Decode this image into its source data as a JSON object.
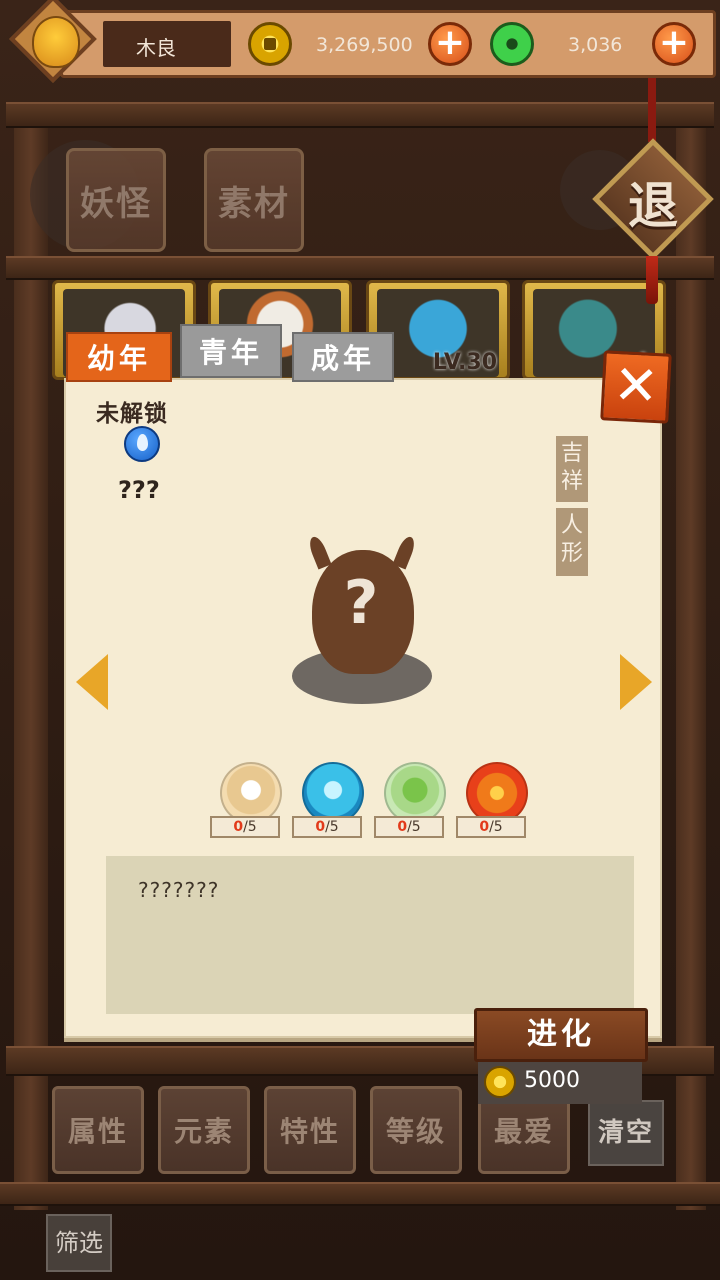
{
  "player": {
    "name": "木良"
  },
  "resources": {
    "coins": "3,269,500",
    "jade": "3,036"
  },
  "exit_sign": {
    "label": "退"
  },
  "categories": [
    {
      "label": "妖怪"
    },
    {
      "label": "素材"
    }
  ],
  "cards": [
    {
      "level": ""
    },
    {
      "level": ""
    },
    {
      "level": "LV.30"
    },
    {
      "level": "L"
    }
  ],
  "age_tabs": [
    {
      "label": "幼年",
      "active": true
    },
    {
      "label": "青年",
      "active": false
    },
    {
      "label": "成年",
      "active": false
    }
  ],
  "detail": {
    "status": "未解锁",
    "element_icon": "water-drop-icon",
    "name": "???",
    "traits": [
      "吉祥",
      "人形"
    ],
    "description": "???????"
  },
  "materials": [
    {
      "icon": "rice-ball-icon",
      "have": "0",
      "need": "/5"
    },
    {
      "icon": "ice-crystal-icon",
      "have": "0",
      "need": "/5"
    },
    {
      "icon": "sprout-icon",
      "have": "0",
      "need": "/5"
    },
    {
      "icon": "fire-rune-icon",
      "have": "0",
      "need": "/5"
    }
  ],
  "evolve": {
    "label": "进化",
    "cost": "5000"
  },
  "bottom_bar": {
    "sort_buttons": [
      "属性",
      "元素",
      "特性",
      "等级",
      "最爱"
    ],
    "clear": "清空",
    "filter": "筛选"
  },
  "colors": {
    "accent_orange": "#e4651a",
    "parchment": "#f6ecd3",
    "wood_dark": "#3d2516",
    "gold": "#e8a628"
  }
}
